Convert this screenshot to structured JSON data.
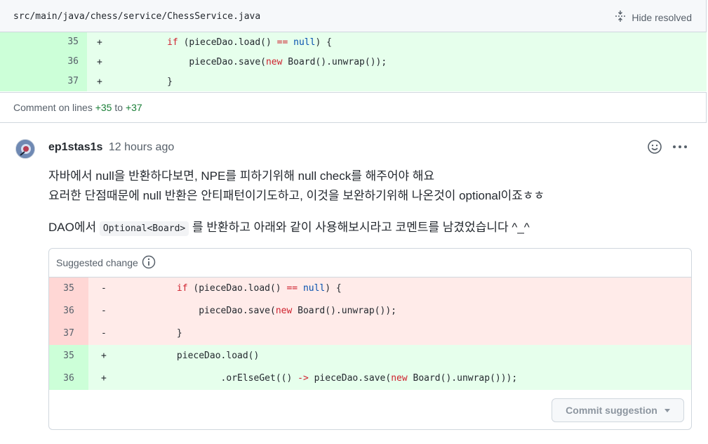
{
  "file": {
    "path": "src/main/java/chess/service/ChessService.java",
    "hide_resolved": "Hide resolved"
  },
  "context_lines": [
    {
      "num": "35",
      "marker": "+",
      "indent": "           ",
      "parts": [
        [
          "kw",
          "if"
        ],
        [
          "t",
          " (pieceDao.load() "
        ],
        [
          "op",
          "=="
        ],
        [
          "t",
          " "
        ],
        [
          "lit",
          "null"
        ],
        [
          "t",
          ") {"
        ]
      ]
    },
    {
      "num": "36",
      "marker": "+",
      "indent": "               ",
      "parts": [
        [
          "t",
          "pieceDao.save("
        ],
        [
          "kw",
          "new"
        ],
        [
          "t",
          " Board().unwrap());"
        ]
      ]
    },
    {
      "num": "37",
      "marker": "+",
      "indent": "           ",
      "parts": [
        [
          "t",
          "}"
        ]
      ]
    }
  ],
  "comment_on": {
    "prefix": "Comment on lines",
    "start": "+35",
    "to": "to",
    "end": "+37"
  },
  "comment": {
    "author": "ep1stas1s",
    "time": "12 hours ago",
    "line1": "자바에서 null을 반환하다보면, NPE를 피하기위해 null check를 해주어야 해요",
    "line2": "요러한 단점때문에 null 반환은 안티패턴이기도하고, 이것을 보완하기위해 나온것이 optional이죠ㅎㅎ",
    "line3_pre": "DAO에서",
    "line3_code": "Optional<Board>",
    "line3_post": "를 반환하고 아래와 같이 사용해보시라고 코멘트를 남겼었습니다 ^_^"
  },
  "suggestion": {
    "header": "Suggested change",
    "lines": [
      {
        "type": "del",
        "num": "35",
        "marker": "-",
        "indent": "            ",
        "parts": [
          [
            "kw",
            "if"
          ],
          [
            "t",
            " (pieceDao.load() "
          ],
          [
            "op",
            "=="
          ],
          [
            "t",
            " "
          ],
          [
            "lit",
            "null"
          ],
          [
            "t",
            ") {"
          ]
        ]
      },
      {
        "type": "del",
        "num": "36",
        "marker": "-",
        "indent": "                ",
        "parts": [
          [
            "t",
            "pieceDao.save("
          ],
          [
            "kw",
            "new"
          ],
          [
            "t",
            " Board().unwrap());"
          ]
        ]
      },
      {
        "type": "del",
        "num": "37",
        "marker": "-",
        "indent": "            ",
        "parts": [
          [
            "t",
            "}"
          ]
        ]
      },
      {
        "type": "add",
        "num": "35",
        "marker": "+",
        "indent": "            ",
        "parts": [
          [
            "t",
            "pieceDao.load()"
          ]
        ]
      },
      {
        "type": "add",
        "num": "36",
        "marker": "+",
        "indent": "                    ",
        "parts": [
          [
            "t",
            ".orElseGet(() "
          ],
          [
            "op",
            "->"
          ],
          [
            "t",
            " pieceDao.save("
          ],
          [
            "kw",
            "new"
          ],
          [
            "t",
            " Board().unwrap()));"
          ]
        ]
      }
    ],
    "commit_label": "Commit suggestion"
  },
  "icons": {
    "unfold": "unfold-icon",
    "smiley": "smiley-icon",
    "kebab": "kebab-horizontal-icon",
    "info": "info-icon",
    "caret": "caret-down-icon"
  },
  "colors": {
    "add_bg": "#e6ffec",
    "add_num_bg": "#ccffd8",
    "del_bg": "#ffebe9",
    "del_num_bg": "#ffd7d5"
  }
}
